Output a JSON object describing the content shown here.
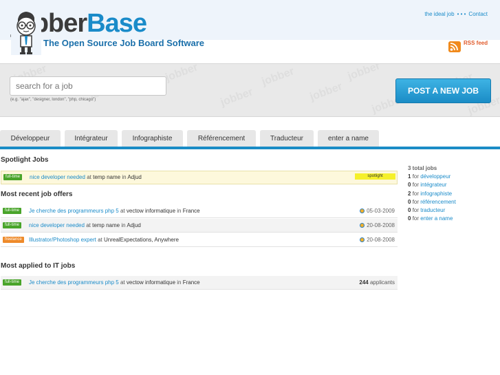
{
  "header": {
    "logo_dark": "jobber",
    "logo_blue": "Base",
    "tagline": "The Open Source Job Board Software",
    "top_links": [
      "the ideal job",
      "Contact"
    ],
    "separator": "• • •",
    "rss_label": "RSS feed"
  },
  "search": {
    "placeholder": "search for a job",
    "hint": "(e.g. \"ajax\", \"designer, london\", \"php, chicago\")",
    "watermark": "jobber",
    "post_button": "POST A NEW JOB"
  },
  "tabs": [
    "Développeur",
    "Intégrateur",
    "Infographiste",
    "Référencement",
    "Traducteur",
    "enter a name"
  ],
  "sections": {
    "spotlight_title": "Spotlight Jobs",
    "recent_title": "Most recent job offers",
    "applied_title": "Most applied to IT jobs"
  },
  "connectors": {
    "at": "at",
    "in": "in"
  },
  "spotlight": {
    "type": "full-time",
    "title": "nice developer needed",
    "company": "temp name",
    "location": "Adjud",
    "tag": "spotlight"
  },
  "recent": [
    {
      "type": "full-time",
      "title": "Je cherche des programmeurs php 5",
      "company": "vectow informatique",
      "location": "France",
      "date": "05-03-2009"
    },
    {
      "type": "full-time",
      "title": "nice developer needed",
      "company": "temp name",
      "location": "Adjud",
      "date": "20-08-2008"
    },
    {
      "type": "freelance",
      "title": "Illustrator/Photoshop expert",
      "company": "UnrealExpectations,",
      "location": "Anywhere",
      "date": "20-08-2008"
    }
  ],
  "applied": [
    {
      "type": "full-time",
      "title": "Je cherche des programmeurs php 5",
      "company": "vectow informatique",
      "location": "France",
      "count": "244",
      "count_label": "applicants"
    }
  ],
  "sidebar": {
    "total": "3 total jobs",
    "for_word": "for",
    "items": [
      {
        "count": "1",
        "name": "développeur"
      },
      {
        "count": "0",
        "name": "intégrateur"
      },
      {
        "count": "2",
        "name": "infographiste"
      },
      {
        "count": "0",
        "name": "référencement"
      },
      {
        "count": "0",
        "name": "traducteur"
      },
      {
        "count": "0",
        "name": "enter a name"
      }
    ]
  },
  "colors": {
    "accent": "#1a8cc6",
    "fulltime": "#49a42a",
    "freelance": "#ee8a2a",
    "spotlight": "#f5f02a"
  }
}
